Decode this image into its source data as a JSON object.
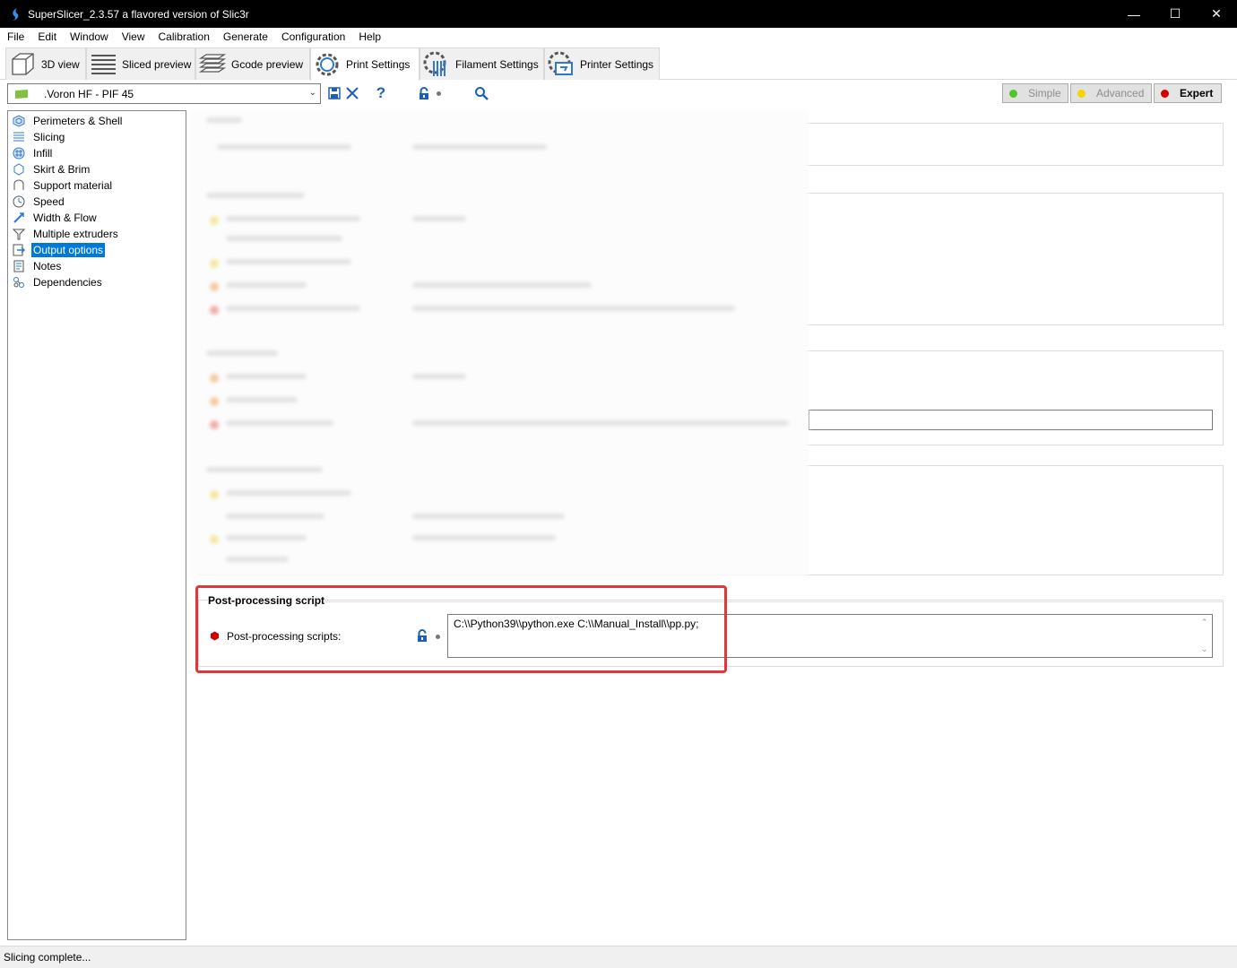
{
  "window": {
    "title": "SuperSlicer_2.3.57 a flavored version of Slic3r",
    "controls": {
      "minimize": "—",
      "maximize": "☐",
      "close": "✕"
    }
  },
  "menu": [
    "File",
    "Edit",
    "Window",
    "View",
    "Calibration",
    "Generate",
    "Configuration",
    "Help"
  ],
  "tabs": [
    {
      "label": "3D view",
      "icon": "cube-icon"
    },
    {
      "label": "Sliced preview",
      "icon": "layers-icon"
    },
    {
      "label": "Gcode preview",
      "icon": "stack-icon"
    },
    {
      "label": "Print Settings",
      "icon": "gear-icon",
      "active": true
    },
    {
      "label": "Filament Settings",
      "icon": "spool-icon"
    },
    {
      "label": "Printer Settings",
      "icon": "printer-gear-icon"
    }
  ],
  "toolbar": {
    "preset_name": ".Voron HF - PIF 45",
    "modes": [
      {
        "label": "Simple",
        "color": "#4ec52b"
      },
      {
        "label": "Advanced",
        "color": "#f5d400"
      },
      {
        "label": "Expert",
        "color": "#d40000",
        "active": true
      }
    ]
  },
  "sidebar": {
    "items": [
      {
        "label": "Perimeters & Shell",
        "icon": "perimeters-icon"
      },
      {
        "label": "Slicing",
        "icon": "slicing-icon"
      },
      {
        "label": "Infill",
        "icon": "infill-icon"
      },
      {
        "label": "Skirt & Brim",
        "icon": "skirt-icon"
      },
      {
        "label": "Support material",
        "icon": "support-icon"
      },
      {
        "label": "Speed",
        "icon": "speed-icon"
      },
      {
        "label": "Width & Flow",
        "icon": "width-flow-icon"
      },
      {
        "label": "Multiple extruders",
        "icon": "extruders-icon"
      },
      {
        "label": "Output options",
        "icon": "output-icon",
        "selected": true
      },
      {
        "label": "Notes",
        "icon": "notes-icon"
      },
      {
        "label": "Dependencies",
        "icon": "dependencies-icon"
      }
    ]
  },
  "post_processing": {
    "group_title": "Post-processing script",
    "label": "Post-processing scripts:",
    "value": "C:\\\\Python39\\\\python.exe C:\\\\Manual_Install\\\\pp.py;"
  },
  "status": "Slicing complete..."
}
